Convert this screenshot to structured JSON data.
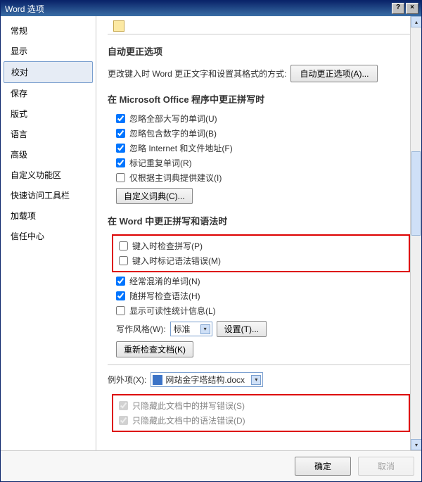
{
  "window": {
    "title": "Word 选项",
    "help_glyph": "?",
    "close_glyph": "×"
  },
  "sidebar": {
    "items": [
      {
        "label": "常规"
      },
      {
        "label": "显示"
      },
      {
        "label": "校对"
      },
      {
        "label": "保存"
      },
      {
        "label": "版式"
      },
      {
        "label": "语言"
      },
      {
        "label": "高级"
      },
      {
        "label": "自定义功能区"
      },
      {
        "label": "快速访问工具栏"
      },
      {
        "label": "加载项"
      },
      {
        "label": "信任中心"
      }
    ],
    "selected_index": 2
  },
  "sections": {
    "autocorrect_title": "自动更正选项",
    "autocorrect_desc": "更改键入时 Word 更正文字和设置其格式的方式:",
    "autocorrect_btn": "自动更正选项(A)...",
    "office_title": "在 Microsoft Office 程序中更正拼写时",
    "cb_uppercase": "忽略全部大写的单词(U)",
    "cb_numbers": "忽略包含数字的单词(B)",
    "cb_internet": "忽略 Internet 和文件地址(F)",
    "cb_repeat": "标记重复单词(R)",
    "cb_mainonly": "仅根据主词典提供建议(I)",
    "custom_dict_btn": "自定义词典(C)...",
    "word_title": "在 Word 中更正拼写和语法时",
    "cb_spell_typing": "键入时检查拼写(P)",
    "cb_grammar_typing": "键入时标记语法错误(M)",
    "cb_confused": "经常混淆的单词(N)",
    "cb_grammar_with_spell": "随拼写检查语法(H)",
    "cb_readability": "显示可读性统计信息(L)",
    "writing_style_label": "写作风格(W):",
    "writing_style_value": "标准",
    "settings_btn": "设置(T)...",
    "recheck_btn": "重新检查文档(K)",
    "exceptions_label": "例外项(X):",
    "exceptions_doc": "网站金字塔结构.docx",
    "cb_hide_spell": "只隐藏此文档中的拼写错误(S)",
    "cb_hide_grammar": "只隐藏此文档中的语法错误(D)"
  },
  "footer": {
    "ok": "确定",
    "cancel": "取消"
  },
  "scroll": {
    "up": "▴",
    "down": "▾",
    "dd": "▾"
  }
}
